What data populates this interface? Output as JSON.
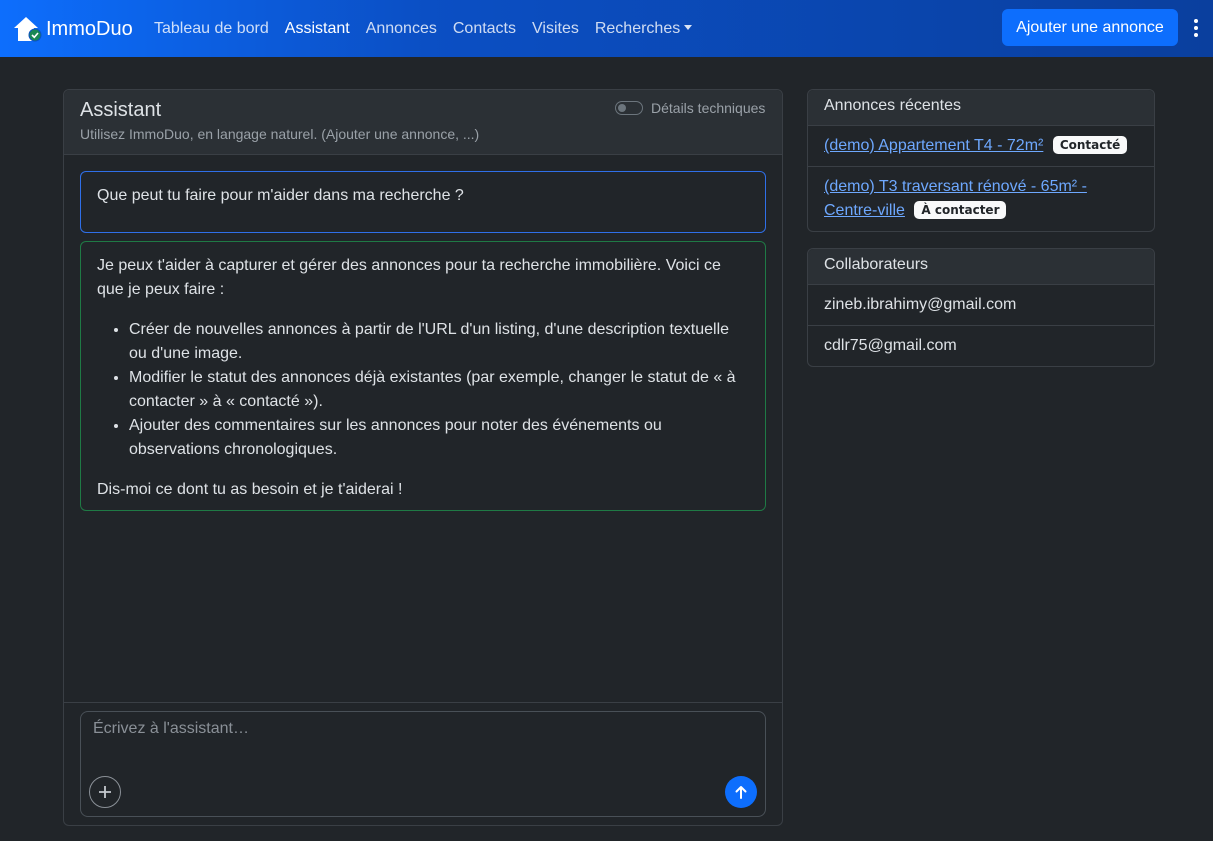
{
  "navbar": {
    "brand": "ImmoDuo",
    "links": [
      {
        "label": "Tableau de bord",
        "active": false
      },
      {
        "label": "Assistant",
        "active": true
      },
      {
        "label": "Annonces",
        "active": false
      },
      {
        "label": "Contacts",
        "active": false
      },
      {
        "label": "Visites",
        "active": false
      },
      {
        "label": "Recherches",
        "active": false,
        "dropdown": true
      }
    ],
    "add_button": "Ajouter une annonce",
    "menu_icon": "kebab-menu-icon",
    "colors": {
      "primary": "#0d6efd",
      "gradient_end": "#0a3f9e"
    }
  },
  "assistant": {
    "title": "Assistant",
    "subtitle": "Utilisez ImmoDuo, en langage naturel. (Ajouter une annonce, ...)",
    "tech_toggle_label": "Détails techniques",
    "tech_toggle_on": false,
    "messages": {
      "user": "Que peut tu faire pour m'aider dans ma recherche ?",
      "bot_intro": "Je peux t'aider à capturer et gérer des annonces pour ta recherche immobilière. Voici ce que je peux faire :",
      "bot_items": [
        "Créer de nouvelles annonces à partir de l'URL d'un listing, d'une description textuelle ou d'une image.",
        "Modifier le statut des annonces déjà existantes (par exemple, changer le statut de « à contacter » à « contacté »).",
        "Ajouter des commentaires sur les annonces pour noter des événements ou observations chronologiques."
      ],
      "bot_outro": "Dis-moi ce dont tu as besoin et je t'aiderai !"
    },
    "composer": {
      "placeholder": "Écrivez à l'assistant…",
      "value": ""
    },
    "colors": {
      "user_border": "#2f6fe8",
      "bot_border": "#1f7a45"
    }
  },
  "recent": {
    "title": "Annonces récentes",
    "items": [
      {
        "label": "(demo) Appartement T4 - 72m²",
        "badge": "Contacté"
      },
      {
        "label": "(demo) T3 traversant rénové - 65m² - Centre-ville",
        "badge": "À contacter"
      }
    ]
  },
  "collaborators": {
    "title": "Collaborateurs",
    "items": [
      "zineb.ibrahimy@gmail.com",
      "cdlr75@gmail.com"
    ]
  }
}
